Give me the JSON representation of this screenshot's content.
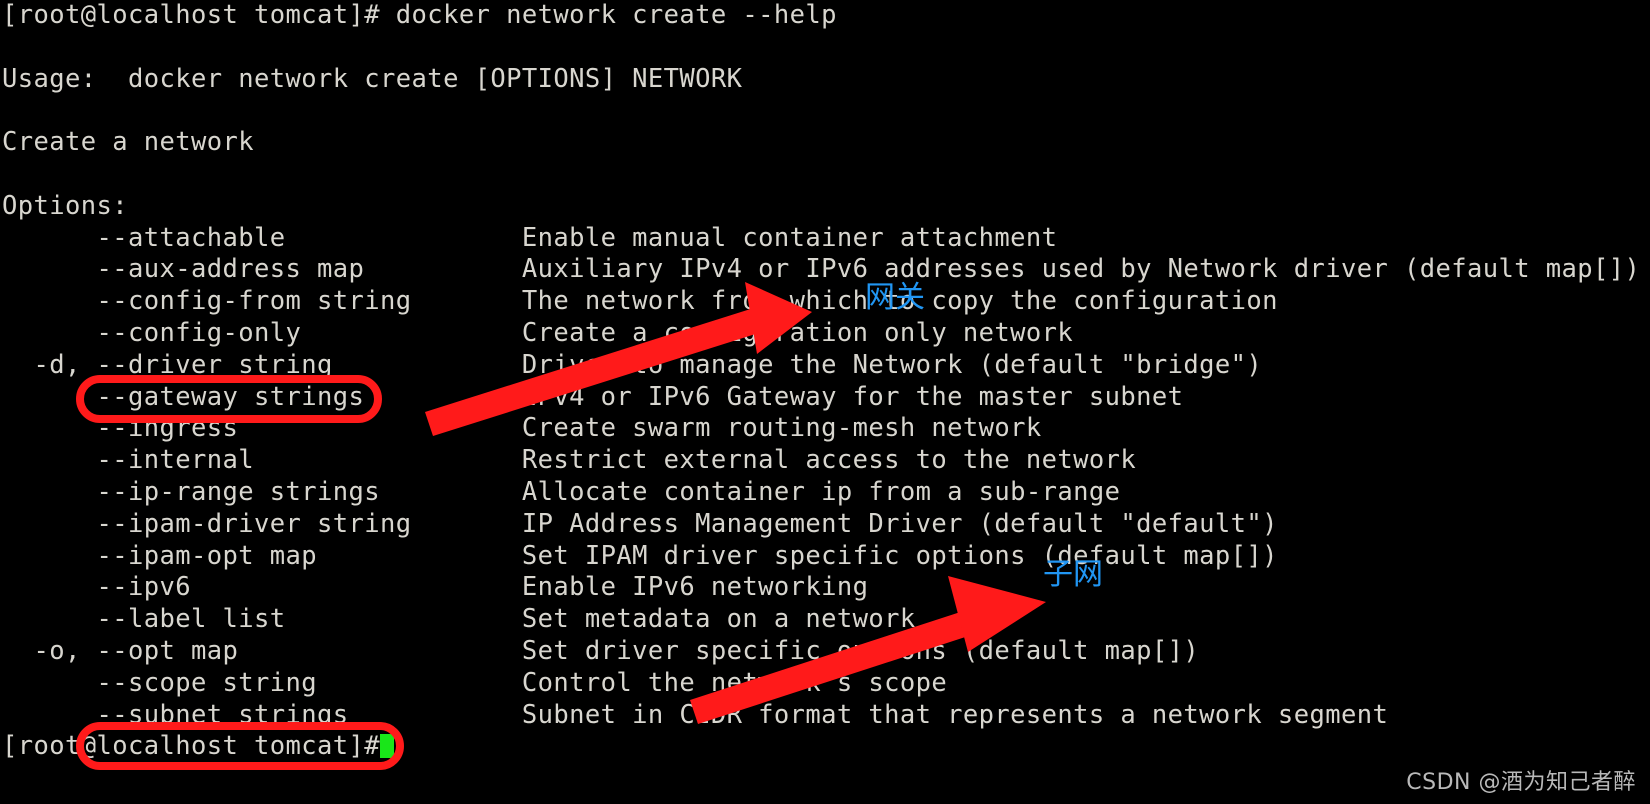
{
  "terminal": {
    "prompt_top": "[root@localhost tomcat]# docker network create --help",
    "blank1": "",
    "usage": "Usage:  docker network create [OPTIONS] NETWORK",
    "blank2": "",
    "summary": "Create a network",
    "blank3": "",
    "options_header": "Options:",
    "options": [
      {
        "flag": "      --attachable",
        "desc": "Enable manual container attachment"
      },
      {
        "flag": "      --aux-address map",
        "desc": "Auxiliary IPv4 or IPv6 addresses used by Network driver (default map[])"
      },
      {
        "flag": "      --config-from string",
        "desc": "The network from which to copy the configuration"
      },
      {
        "flag": "      --config-only",
        "desc": "Create a configuration only network"
      },
      {
        "flag": "  -d, --driver string",
        "desc": "Driver to manage the Network (default \"bridge\")"
      },
      {
        "flag": "      --gateway strings",
        "desc": "IPv4 or IPv6 Gateway for the master subnet"
      },
      {
        "flag": "      --ingress",
        "desc": "Create swarm routing-mesh network"
      },
      {
        "flag": "      --internal",
        "desc": "Restrict external access to the network"
      },
      {
        "flag": "      --ip-range strings",
        "desc": "Allocate container ip from a sub-range"
      },
      {
        "flag": "      --ipam-driver string",
        "desc": "IP Address Management Driver (default \"default\")"
      },
      {
        "flag": "      --ipam-opt map",
        "desc": "Set IPAM driver specific options (default map[])"
      },
      {
        "flag": "      --ipv6",
        "desc": "Enable IPv6 networking"
      },
      {
        "flag": "      --label list",
        "desc": "Set metadata on a network"
      },
      {
        "flag": "  -o, --opt map",
        "desc": "Set driver specific options (default map[])"
      },
      {
        "flag": "      --scope string",
        "desc": "Control the network's scope"
      },
      {
        "flag": "      --subnet strings",
        "desc": "Subnet in CIDR format that represents a network segment"
      }
    ],
    "prompt_bottom": "[root@localhost tomcat]#",
    "cursor_color": "#19e619",
    "text_color": "#d8d6cf",
    "background_color": "#000000"
  },
  "annotations": {
    "highlight_color": "#ff1a1a",
    "note_color": "#2196f3",
    "gateway_note": "网关",
    "subnet_note": "子网",
    "ellipse_gateway_target": "--gateway strings",
    "ellipse_subnet_target": "--subnet strings"
  },
  "watermark": {
    "text": "CSDN @酒为知己者醉"
  }
}
